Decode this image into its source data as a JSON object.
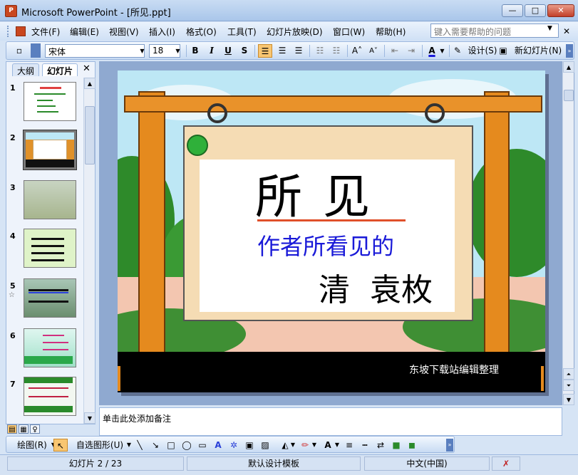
{
  "window": {
    "title": "Microsoft PowerPoint - [所见.ppt]",
    "app_icon_text": "P",
    "min": "—",
    "max": "□",
    "close": "✕"
  },
  "menu": {
    "items": [
      "文件(F)",
      "编辑(E)",
      "视图(V)",
      "插入(I)",
      "格式(O)",
      "工具(T)",
      "幻灯片放映(D)",
      "窗口(W)",
      "帮助(H)"
    ],
    "help_placeholder": "键入需要帮助的问题"
  },
  "toolbar": {
    "font_name": "宋体",
    "font_size": "18",
    "bold": "B",
    "italic": "I",
    "underline": "U",
    "shadow": "S",
    "design_label": "设计(S)",
    "new_slide_label": "新幻灯片(N)"
  },
  "pane": {
    "tab_outline": "大纲",
    "tab_slides": "幻灯片",
    "close": "✕",
    "thumbs": [
      {
        "num": "1",
        "star": false
      },
      {
        "num": "2",
        "star": false
      },
      {
        "num": "3",
        "star": false
      },
      {
        "num": "4",
        "star": false
      },
      {
        "num": "5",
        "star": true
      },
      {
        "num": "6",
        "star": false
      },
      {
        "num": "7",
        "star": false
      }
    ]
  },
  "slide": {
    "title": "所 见",
    "subtitle": "作者所看见的",
    "author": "清  袁枚",
    "footer": "东坡下载站编辑整理"
  },
  "notes": {
    "placeholder": "单击此处添加备注"
  },
  "draw": {
    "draw_label": "绘图(R)",
    "autoshape_label": "自选图形(U)"
  },
  "status": {
    "slide_count": "幻灯片 2 / 23",
    "template": "默认设计模板",
    "language": "中文(中国)"
  },
  "colors": {
    "title_red_underline": "#e0502a",
    "subtitle_blue": "#1a1ad8",
    "footer_bg": "#000000",
    "wood": "#e58a1e"
  }
}
